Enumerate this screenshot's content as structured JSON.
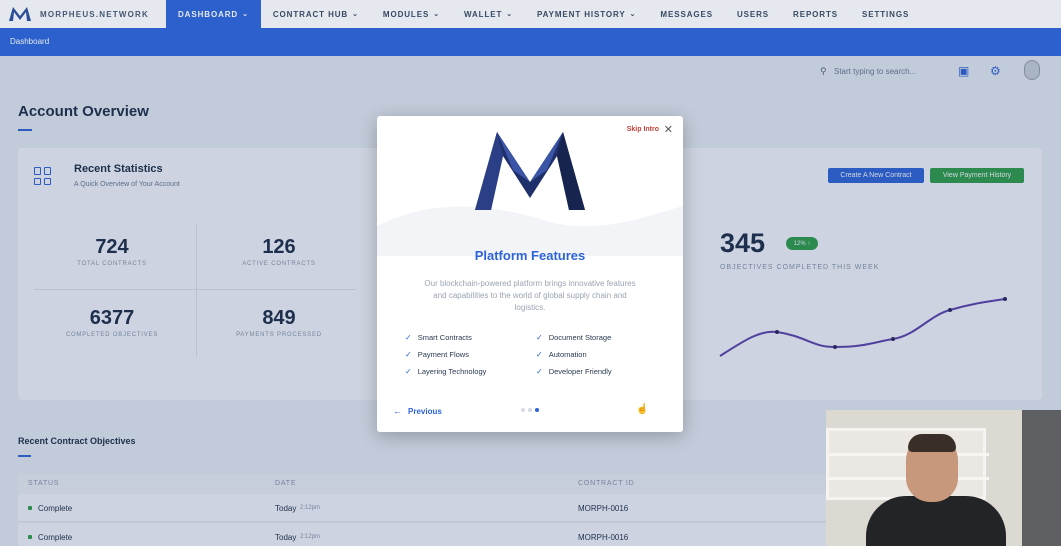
{
  "nav": {
    "brand": "MORPHEUS.NETWORK",
    "items": [
      {
        "label": "DASHBOARD",
        "caret": true,
        "active": true
      },
      {
        "label": "CONTRACT HUB",
        "caret": true
      },
      {
        "label": "MODULES",
        "caret": true
      },
      {
        "label": "WALLET",
        "caret": true
      },
      {
        "label": "PAYMENT HISTORY",
        "caret": true
      },
      {
        "label": "MESSAGES"
      },
      {
        "label": "USERS"
      },
      {
        "label": "REPORTS"
      },
      {
        "label": "SETTINGS"
      }
    ],
    "breadcrumb": "Dashboard"
  },
  "header": {
    "search_placeholder": "Start typing to search..."
  },
  "page": {
    "title": "Account Overview",
    "stats_card": {
      "title": "Recent Statistics",
      "subtitle": "A Quick Overview of Your Account",
      "stats": [
        {
          "value": "724",
          "label": "TOTAL CONTRACTS"
        },
        {
          "value": "126",
          "label": "ACTIVE CONTRACTS"
        },
        {
          "value": "6377",
          "label": "COMPLETED OBJECTIVES"
        },
        {
          "value": "849",
          "label": "PAYMENTS PROCESSED"
        }
      ],
      "create_contract_btn": "Create A New Contract",
      "payment_history_btn": "View Payment History",
      "objectives_value": "345",
      "objectives_badge": "12% ↑",
      "objectives_label": "OBJECTIVES COMPLETED THIS WEEK"
    },
    "recent": {
      "title": "Recent Contract Objectives",
      "columns": [
        "STATUS",
        "DATE",
        "CONTRACT ID"
      ],
      "rows": [
        {
          "status": "Complete",
          "date": "Today",
          "time": "2:12pm",
          "contract_id": "MORPH-0016"
        },
        {
          "status": "Complete",
          "date": "Today",
          "time": "2:12pm",
          "contract_id": "MORPH-0016"
        }
      ]
    }
  },
  "modal": {
    "skip": "Skip Intro",
    "title": "Platform Features",
    "description": "Our blockchain-powered platform brings innovative features and capabilities to the world of global supply chain and logistics.",
    "features_left": [
      "Smart Contracts",
      "Payment Flows",
      "Layering Technology"
    ],
    "features_right": [
      "Document Storage",
      "Automation",
      "Developer Friendly"
    ],
    "previous": "Previous"
  },
  "colors": {
    "primary": "#2d63d8",
    "success": "#2e9e45",
    "skip": "#c0443b",
    "sparkline": "#5b3fa8"
  }
}
